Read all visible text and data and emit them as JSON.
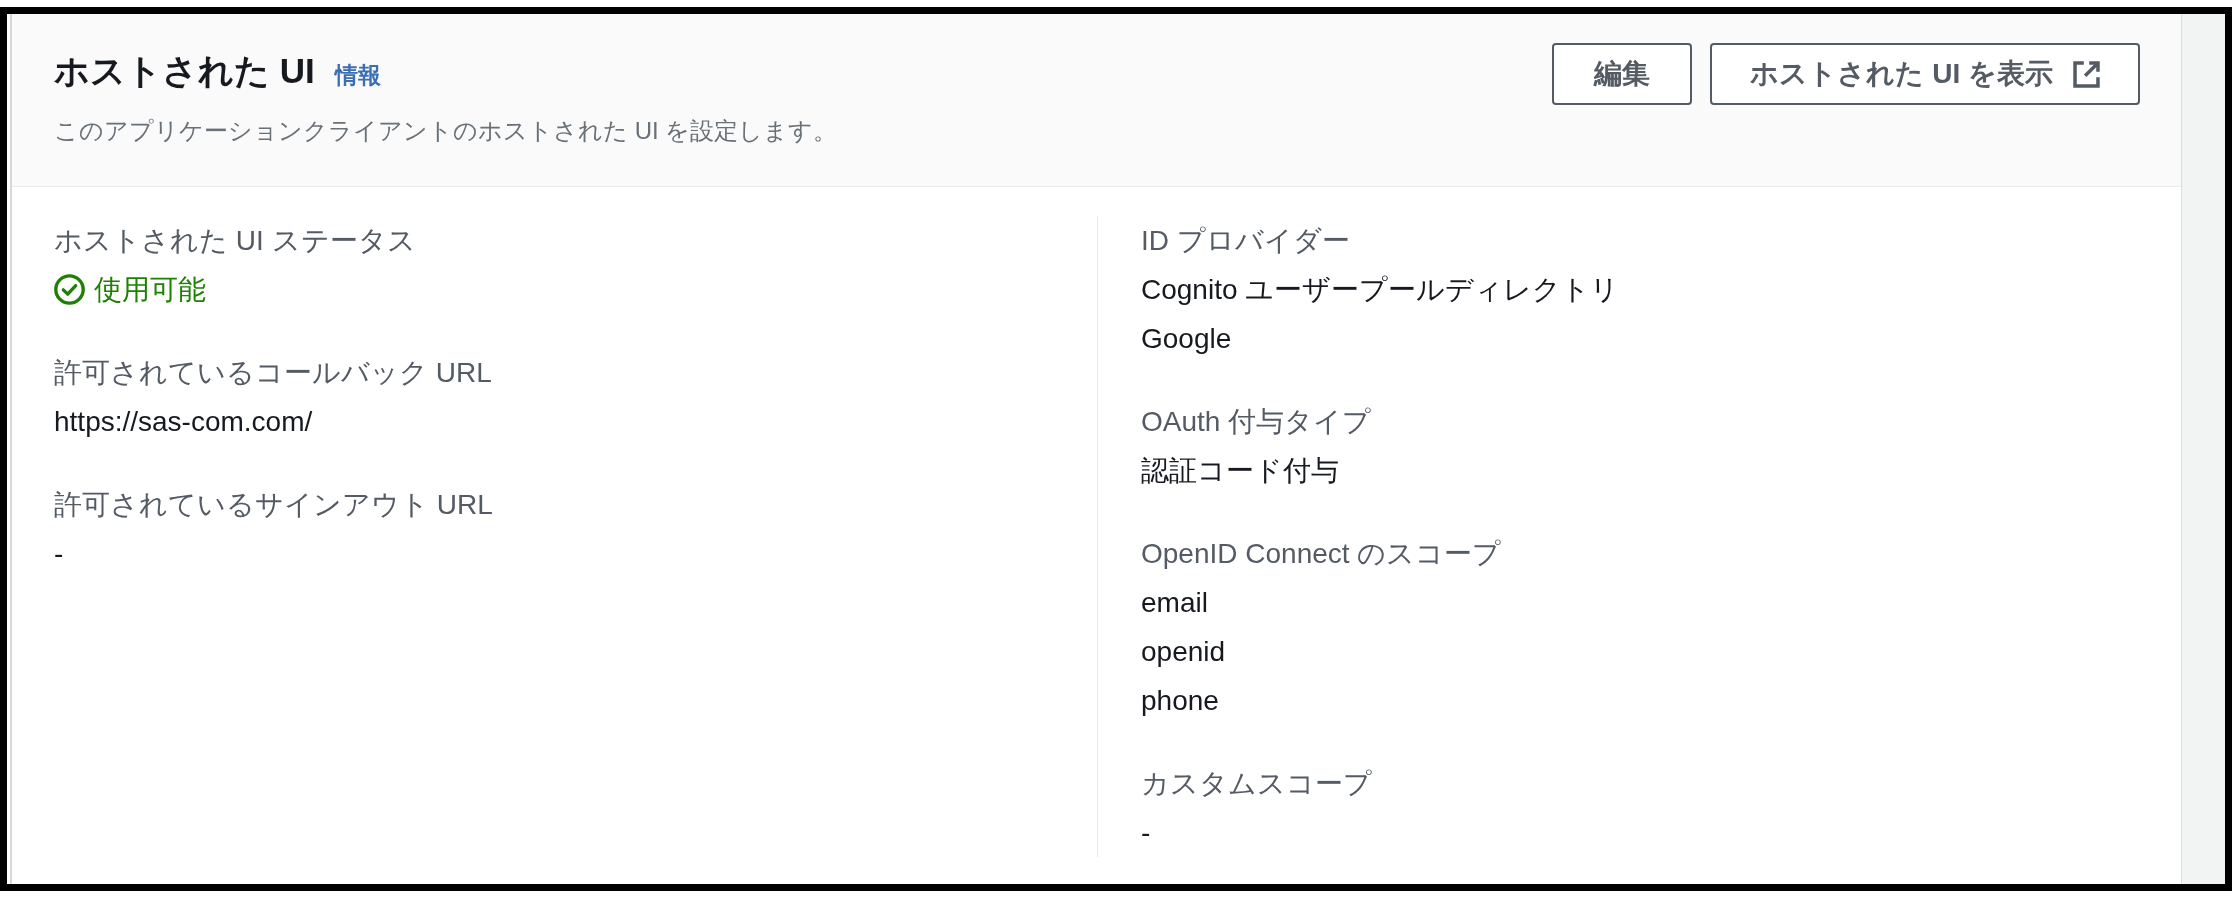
{
  "section": {
    "title": "ホストされた UI",
    "info_link": "情報",
    "description": "このアプリケーションクライアントのホストされた UI を設定します。",
    "buttons": [
      {
        "label": "編集",
        "kind": "edit"
      },
      {
        "label": "ホストされた UI を表示",
        "kind": "external-link"
      }
    ]
  },
  "columns": [
    {
      "fields": [
        {
          "label": "ホストされた UI ステータス",
          "kind": "status",
          "values": [
            "使用可能"
          ]
        },
        {
          "label": "許可されているコールバック URL",
          "kind": "text",
          "values": [
            "https://sas-com.com/"
          ]
        },
        {
          "label": "許可されているサインアウト URL",
          "kind": "text",
          "values": [
            "-"
          ]
        }
      ]
    },
    {
      "fields": [
        {
          "label": "ID プロバイダー",
          "kind": "text",
          "values": [
            "Cognito ユーザープールディレクトリ",
            "Google"
          ]
        },
        {
          "label": "OAuth 付与タイプ",
          "kind": "text",
          "values": [
            "認証コード付与"
          ]
        },
        {
          "label": "OpenID Connect のスコープ",
          "kind": "text",
          "values": [
            "email",
            "openid",
            "phone"
          ]
        },
        {
          "label": "カスタムスコープ",
          "kind": "text",
          "values": [
            "-"
          ]
        }
      ]
    }
  ]
}
